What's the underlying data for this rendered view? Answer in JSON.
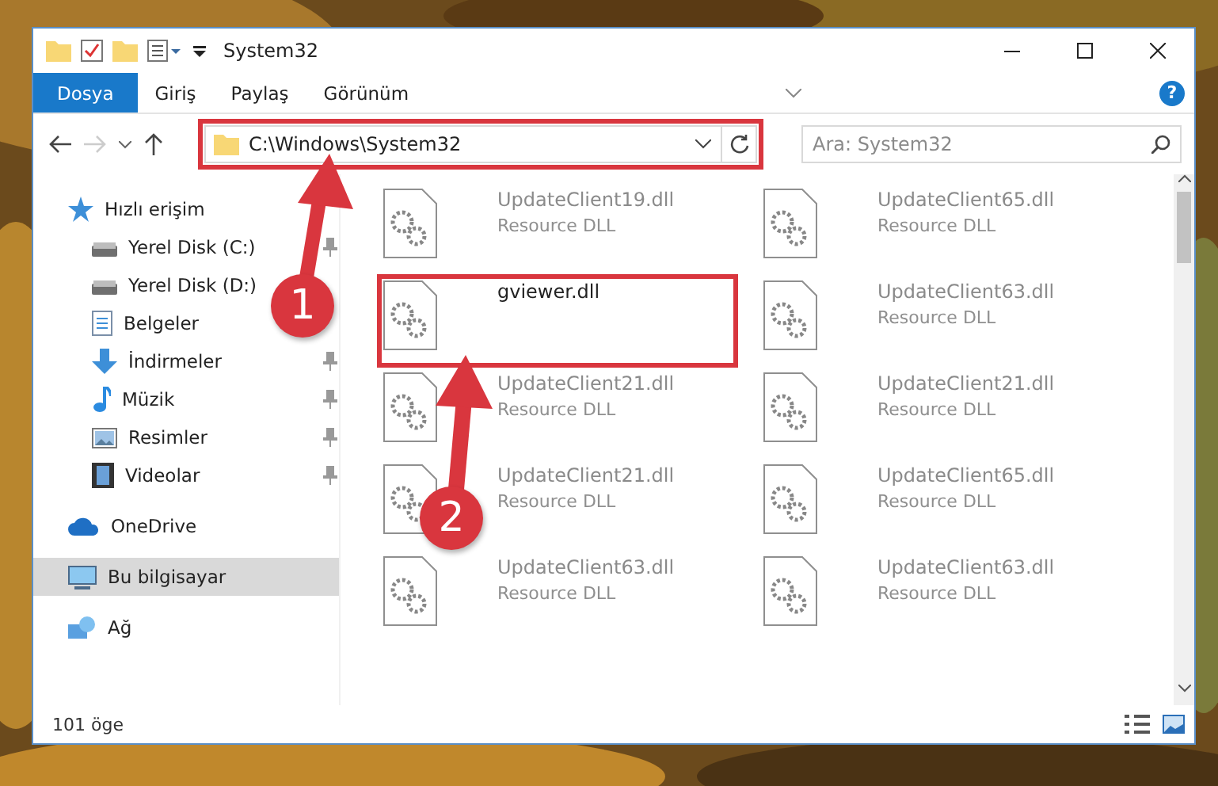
{
  "window": {
    "title": "System32"
  },
  "ribbon": {
    "tabs": [
      {
        "label": "Dosya",
        "selected": true
      },
      {
        "label": "Giriş",
        "selected": false
      },
      {
        "label": "Paylaş",
        "selected": false
      },
      {
        "label": "Görünüm",
        "selected": false
      }
    ],
    "help": "?"
  },
  "navigation": {
    "forward_disabled": true,
    "address": "C:\\Windows\\System32",
    "search": {
      "placeholder": "Ara: System32"
    }
  },
  "sidebar": {
    "items": [
      {
        "label": "Hızlı erişim",
        "kind": "star",
        "selected": false,
        "children": [
          {
            "label": "Yerel Disk (C:)",
            "kind": "drive",
            "pinned": true,
            "selected": false
          },
          {
            "label": "Yerel Disk (D:)",
            "kind": "drive",
            "pinned": false,
            "selected": false
          },
          {
            "label": "Belgeler",
            "kind": "documents",
            "pinned": false,
            "selected": false
          },
          {
            "label": "İndirmeler",
            "kind": "downloads",
            "pinned": true,
            "selected": false
          },
          {
            "label": "Müzik",
            "kind": "music",
            "pinned": true,
            "selected": false
          },
          {
            "label": "Resimler",
            "kind": "pictures",
            "pinned": true,
            "selected": false
          },
          {
            "label": "Videolar",
            "kind": "videos",
            "pinned": true,
            "selected": false
          }
        ]
      },
      {
        "label": "OneDrive",
        "kind": "cloud",
        "selected": false
      },
      {
        "label": "Bu bilgisayar",
        "kind": "computer",
        "selected": true
      },
      {
        "label": "Ağ",
        "kind": "network",
        "selected": false
      }
    ]
  },
  "files": [
    {
      "name": "UpdateClient19.dll",
      "type": "Resource DLL",
      "faded": true
    },
    {
      "name": "UpdateClient65.dll",
      "type": "Resource DLL",
      "faded": true
    },
    {
      "name": "gviewer.dll",
      "faded": false
    },
    {
      "name": "UpdateClient63.dll",
      "type": "Resource DLL",
      "faded": true
    },
    {
      "name": "UpdateClient21.dll",
      "type": "Resource DLL",
      "faded": true
    },
    {
      "name": "UpdateClient21.dll",
      "type": "Resource DLL",
      "faded": true
    },
    {
      "name": "UpdateClient21.dll",
      "type": "Resource DLL",
      "faded": true
    },
    {
      "name": "UpdateClient65.dll",
      "type": "Resource DLL",
      "faded": true
    },
    {
      "name": "UpdateClient63.dll",
      "type": "Resource DLL",
      "faded": true
    },
    {
      "name": "UpdateClient63.dll",
      "type": "Resource DLL",
      "faded": true
    }
  ],
  "status_bar": {
    "count": "101 öge"
  },
  "annotations": [
    {
      "label": "1"
    },
    {
      "label": "2"
    }
  ]
}
